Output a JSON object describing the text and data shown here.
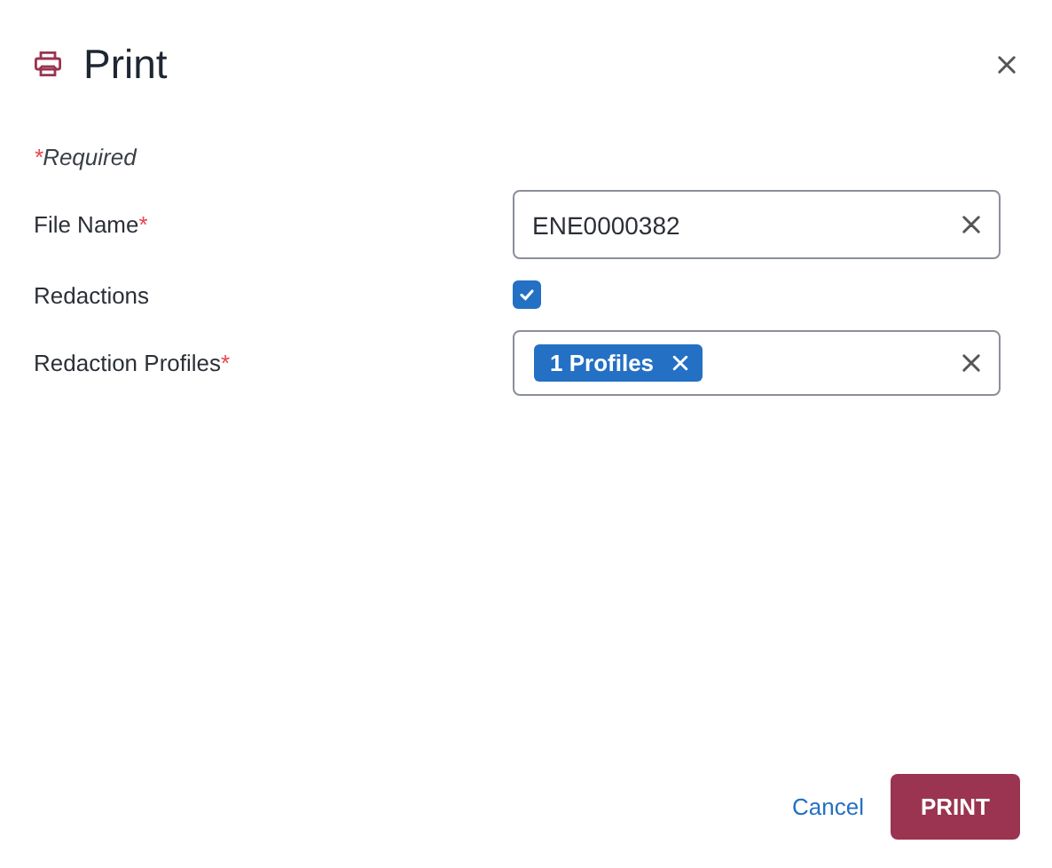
{
  "dialog": {
    "title": "Print"
  },
  "required_note": {
    "mark": "*",
    "text": "Required"
  },
  "fields": [
    {
      "kind": "text",
      "label": "File Name",
      "required": true,
      "required_mark": "*",
      "value": "ENE0000382"
    },
    {
      "kind": "checkbox",
      "label": "Redactions",
      "required": false,
      "checked": true
    },
    {
      "kind": "tags",
      "label": "Redaction Profiles",
      "required": true,
      "required_mark": "*",
      "tags": [
        "1 Profiles"
      ]
    }
  ],
  "buttons": [
    {
      "kind": "link",
      "label": "Cancel"
    },
    {
      "kind": "primary",
      "label": "PRINT"
    }
  ]
}
